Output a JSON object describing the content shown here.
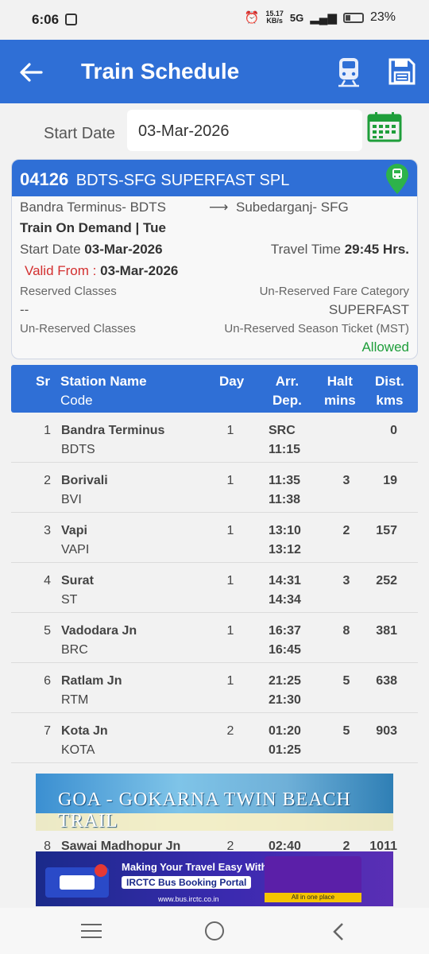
{
  "status_bar": {
    "time": "6:06",
    "net_speed_top": "15.17",
    "net_speed_bottom": "KB/s",
    "network": "5G",
    "battery": "23%"
  },
  "app_bar": {
    "title": "Train Schedule"
  },
  "start_date": {
    "label": "Start Date",
    "value": "03-Mar-2026"
  },
  "train": {
    "number": "04126",
    "name": "BDTS-SFG SUPERFAST SPL",
    "from": "Bandra Terminus- BDTS",
    "to": "Subedarganj- SFG",
    "run_days": "Train On Demand | Tue",
    "start_label": "Start Date",
    "start_value": "03-Mar-2026",
    "travel_label": "Travel Time",
    "travel_value": "29:45 Hrs.",
    "valid_label": "Valid From :",
    "valid_value": "03-Mar-2026",
    "reserved_label": "Reserved Classes",
    "reserved_value": "--",
    "fare_label": "Un-Reserved Fare Category",
    "fare_value": "SUPERFAST",
    "unreserved_label": "Un-Reserved Classes",
    "mst_label": "Un-Reserved Season Ticket (MST)",
    "mst_value": "Allowed"
  },
  "table": {
    "headers": {
      "sr": "Sr",
      "station_1": "Station Name",
      "station_2": "Code",
      "day": "Day",
      "arr": "Arr.",
      "dep": "Dep.",
      "halt_1": "Halt",
      "halt_2": "mins",
      "dist_1": "Dist.",
      "dist_2": "kms"
    },
    "rows": [
      {
        "sr": "1",
        "name": "Bandra Terminus",
        "code": "BDTS",
        "day": "1",
        "arr": "SRC",
        "dep": "11:15",
        "halt": "",
        "dist": "0"
      },
      {
        "sr": "2",
        "name": "Borivali",
        "code": "BVI",
        "day": "1",
        "arr": "11:35",
        "dep": "11:38",
        "halt": "3",
        "dist": "19"
      },
      {
        "sr": "3",
        "name": "Vapi",
        "code": "VAPI",
        "day": "1",
        "arr": "13:10",
        "dep": "13:12",
        "halt": "2",
        "dist": "157"
      },
      {
        "sr": "4",
        "name": "Surat",
        "code": "ST",
        "day": "1",
        "arr": "14:31",
        "dep": "14:34",
        "halt": "3",
        "dist": "252"
      },
      {
        "sr": "5",
        "name": "Vadodara Jn",
        "code": "BRC",
        "day": "1",
        "arr": "16:37",
        "dep": "16:45",
        "halt": "8",
        "dist": "381"
      },
      {
        "sr": "6",
        "name": "Ratlam Jn",
        "code": "RTM",
        "day": "1",
        "arr": "21:25",
        "dep": "21:30",
        "halt": "5",
        "dist": "638"
      },
      {
        "sr": "7",
        "name": "Kota Jn",
        "code": "KOTA",
        "day": "2",
        "arr": "01:20",
        "dep": "01:25",
        "halt": "5",
        "dist": "903"
      },
      {
        "sr": "8",
        "name": "Sawai Madhopur Jn",
        "code": "",
        "day": "2",
        "arr": "02:40",
        "dep": "",
        "halt": "2",
        "dist": "1011"
      }
    ]
  },
  "ads": {
    "ad1_title": "GOA - GOKARNA TWIN BEACH TRAIL",
    "ad2_line1": "Making Your Travel Easy With",
    "ad2_line2": "IRCTC Bus Booking Portal",
    "ad2_url": "www.bus.irctc.co.in",
    "ad2_side": "All in one place"
  }
}
